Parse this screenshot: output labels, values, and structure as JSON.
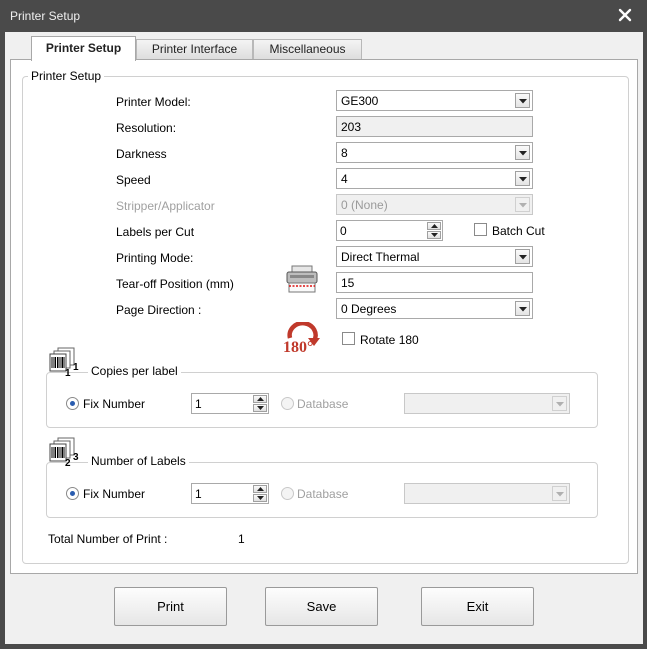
{
  "window": {
    "title": "Printer Setup"
  },
  "tabs": [
    {
      "label": "Printer Setup",
      "active": true
    },
    {
      "label": "Printer Interface",
      "active": false
    },
    {
      "label": "Miscellaneous",
      "active": false
    }
  ],
  "printer_setup_group": {
    "legend": "Printer Setup",
    "printer_model": {
      "label": "Printer Model:",
      "value": "GE300"
    },
    "resolution": {
      "label": "Resolution:",
      "value": "203"
    },
    "darkness": {
      "label": "Darkness",
      "value": "8"
    },
    "speed": {
      "label": "Speed",
      "value": "4"
    },
    "stripper": {
      "label": "Stripper/Applicator",
      "value": "0 (None)"
    },
    "labels_per_cut": {
      "label": "Labels per Cut",
      "value": "0"
    },
    "batch_cut": {
      "label": "Batch Cut",
      "checked": false
    },
    "printing_mode": {
      "label": "Printing Mode:",
      "value": "Direct Thermal"
    },
    "tear_off": {
      "label": "Tear-off Position  (mm)",
      "value": "15"
    },
    "page_direction": {
      "label": "Page Direction :",
      "value": "0 Degrees"
    },
    "rotate": {
      "label": "Rotate 180",
      "checked": false,
      "icon_text": "180°"
    }
  },
  "copies_group": {
    "legend": "Copies per label",
    "icon_digits": {
      "a": "1",
      "b": "1"
    },
    "fix_number": {
      "label": "Fix Number",
      "checked": true,
      "value": "1"
    },
    "database": {
      "label": "Database",
      "checked": false,
      "value": ""
    }
  },
  "labels_group": {
    "legend": "Number of Labels",
    "icon_digits": {
      "a": "2",
      "b": "3"
    },
    "fix_number": {
      "label": "Fix Number",
      "checked": true,
      "value": "1"
    },
    "database": {
      "label": "Database",
      "checked": false,
      "value": ""
    }
  },
  "total": {
    "label": "Total Number of Print :",
    "value": "1"
  },
  "buttons": {
    "print": "Print",
    "save": "Save",
    "exit": "Exit"
  },
  "colors": {
    "titlebar": "#4a4a4a",
    "accent_red": "#c0392b",
    "radio_dot": "#2a5db0"
  }
}
